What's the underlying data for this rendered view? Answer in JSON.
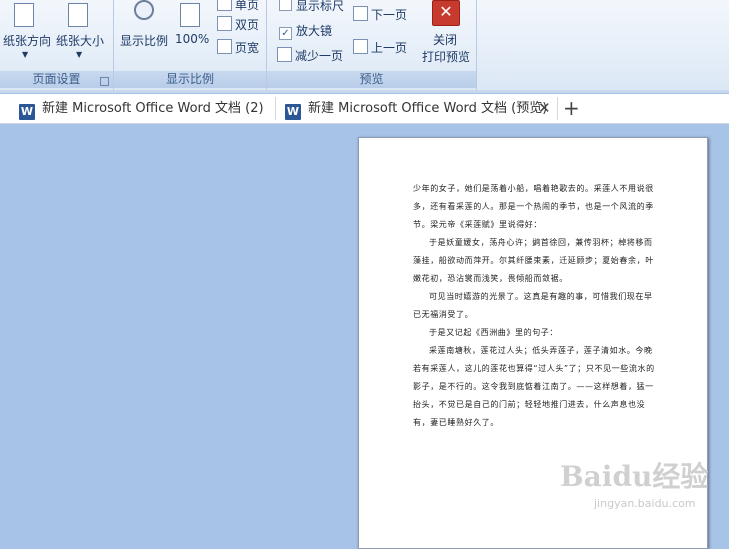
{
  "ribbon": {
    "page_setup": {
      "orientation_label": "纸张方向",
      "size_label": "纸张大小",
      "group_label": "页面设置"
    },
    "zoom": {
      "zoom_label": "显示比例",
      "percent_label": "100%",
      "single_page": "单页",
      "two_pages": "双页",
      "page_width": "页宽",
      "group_label": "显示比例"
    },
    "preview": {
      "show_ruler": "显示标尺",
      "magnifier": "放大镜",
      "shrink_one_page": "减少一页",
      "next_page": "下一页",
      "prev_page": "上一页",
      "close_preview_line1": "关闭",
      "close_preview_line2": "打印预览",
      "close_glyph": "✕",
      "group_label": "预览"
    }
  },
  "tabs": [
    {
      "label": "新建 Microsoft Office Word 文档 (2)",
      "icon": "W"
    },
    {
      "label": "新建 Microsoft Office Word 文档 (预览)",
      "icon": "W",
      "close": "✕"
    }
  ],
  "tab_add": "+",
  "document": {
    "paragraphs": [
      "少年的女子，她们是荡着小船，唱着艳歌去的。采莲人不用说很多，还有看采莲的人。那是一个热闹的季节，也是一个风流的季节。梁元帝《采莲赋》里说得好：",
      "于是妖童媛女，荡舟心许；鹢首徐回，兼传羽杯；棹将移而藻挂，船欲动而萍开。尔其纤腰束素，迁延顾步；夏始春余，叶嫩花初，恐沾裳而浅笑，畏倾船而敛裾。",
      "可见当时嬉游的光景了。这真是有趣的事，可惜我们现在早已无福消受了。",
      "于是又记起《西洲曲》里的句子：",
      "采莲南塘秋，莲花过人头；低头弄莲子，莲子清如水。今晚若有采莲人，这儿的莲花也算得“过人头”了；只不见一些流水的影子，是不行的。这令我到底惦着江南了。——这样想着，猛一抬头，不觉已是自己的门前；轻轻地推门进去，什么声息也没有，妻已睡熟好久了。"
    ]
  },
  "watermark": {
    "text": "Baidu经验",
    "url": "jingyan.baidu.com"
  }
}
